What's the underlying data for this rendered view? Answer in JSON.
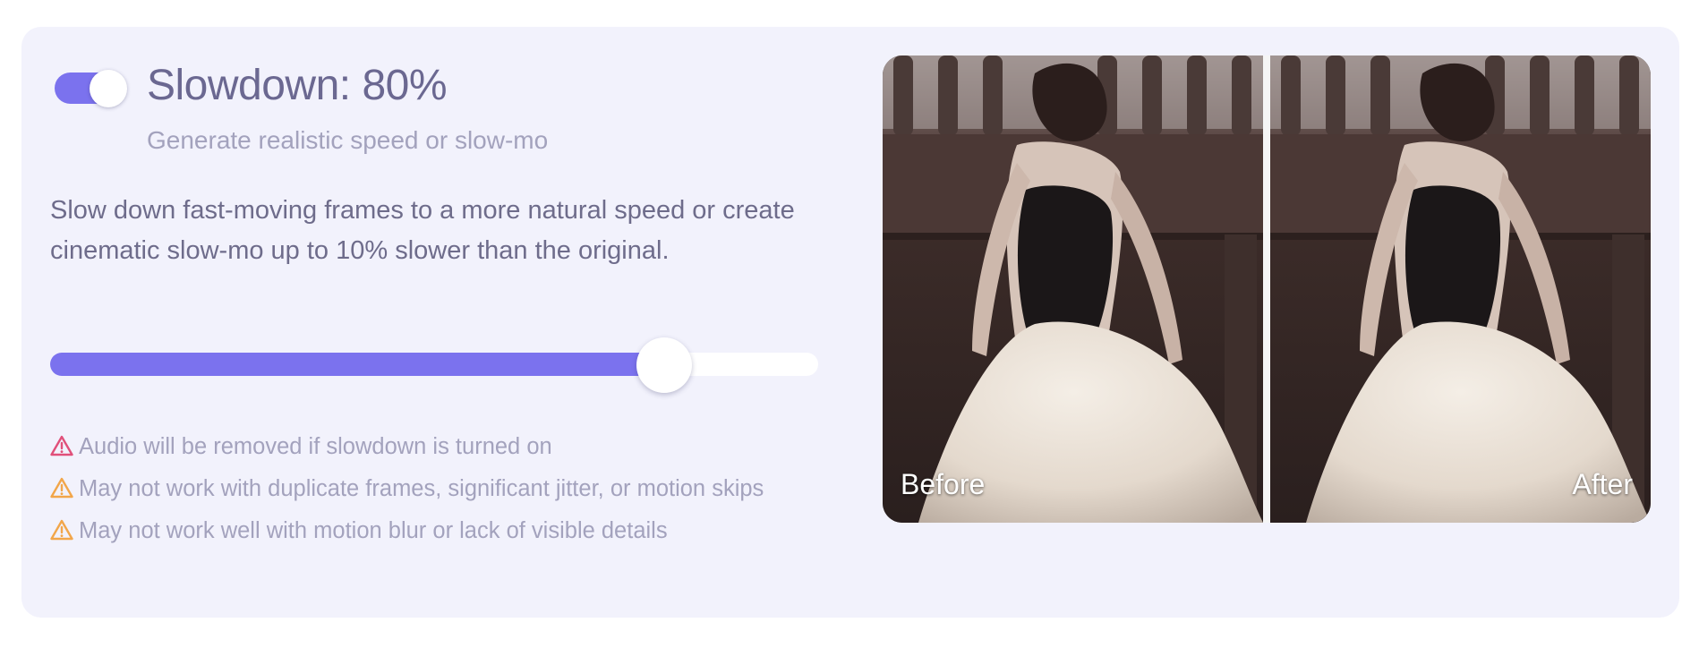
{
  "feature": {
    "title": "Slowdown: 80%",
    "subtitle": "Generate realistic speed or slow-mo",
    "description": "Slow down fast-moving frames to a more natural speed or create cinematic slow-mo up to 10% slower than the original.",
    "enabled": true,
    "slider_value_fraction": 0.8
  },
  "warnings": [
    {
      "text": "Audio will be removed if slowdown is turned on",
      "icon": "warning-icon",
      "color": "#e0507a"
    },
    {
      "text": "May not work with duplicate frames, significant jitter, or motion skips",
      "icon": "warning-icon",
      "color": "#f2a64a"
    },
    {
      "text": "May not work well with motion blur or lack of visible details",
      "icon": "warning-icon",
      "color": "#f2a64a"
    }
  ],
  "comparison": {
    "before_label": "Before",
    "after_label": "After"
  },
  "colors": {
    "accent": "#7b72ee",
    "card_background": "#f2f2fc"
  }
}
